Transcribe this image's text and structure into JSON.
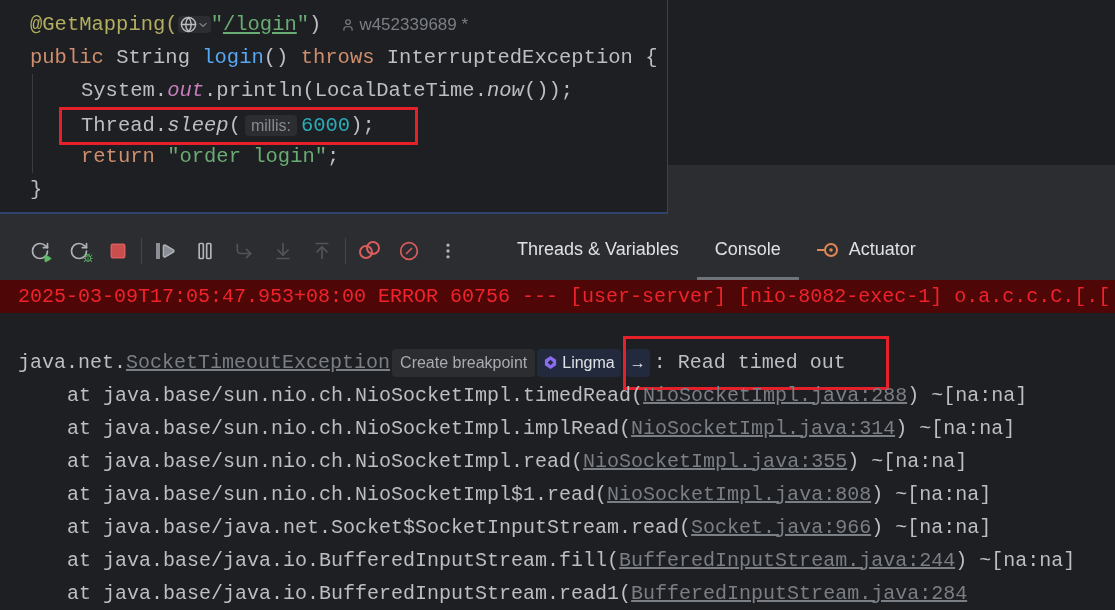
{
  "editor": {
    "lines": [
      {
        "indent": false,
        "highlighted": false,
        "tokens": [
          {
            "kind": "annotation",
            "text": "@GetMapping("
          },
          {
            "kind": "url_icon"
          },
          {
            "kind": "string",
            "text": "\""
          },
          {
            "kind": "string_link",
            "text": "/login"
          },
          {
            "kind": "string",
            "text": "\""
          },
          {
            "kind": "plain",
            "text": ")"
          },
          {
            "kind": "author",
            "text": "w452339689 *"
          }
        ]
      },
      {
        "indent": false,
        "highlighted": false,
        "tokens": [
          {
            "kind": "keyword",
            "text": "public "
          },
          {
            "kind": "plain",
            "text": "String "
          },
          {
            "kind": "method",
            "text": "login"
          },
          {
            "kind": "plain",
            "text": "() "
          },
          {
            "kind": "keyword",
            "text": "throws "
          },
          {
            "kind": "plain",
            "text": "InterruptedException {"
          }
        ]
      },
      {
        "indent": true,
        "highlighted": false,
        "tokens": [
          {
            "kind": "plain",
            "text": "System."
          },
          {
            "kind": "field",
            "text": "out"
          },
          {
            "kind": "plain",
            "text": ".println(LocalDateTime."
          },
          {
            "kind": "static",
            "text": "now"
          },
          {
            "kind": "plain",
            "text": "());"
          }
        ]
      },
      {
        "indent": true,
        "highlighted": true,
        "tokens": [
          {
            "kind": "plain",
            "text": "Thread."
          },
          {
            "kind": "static",
            "text": "sleep"
          },
          {
            "kind": "plain",
            "text": "("
          },
          {
            "kind": "hint",
            "text": "millis:"
          },
          {
            "kind": "number",
            "text": "6000"
          },
          {
            "kind": "plain",
            "text": ");"
          }
        ]
      },
      {
        "indent": true,
        "highlighted": false,
        "tokens": [
          {
            "kind": "keyword",
            "text": "return "
          },
          {
            "kind": "string",
            "text": "\"order login\""
          },
          {
            "kind": "plain",
            "text": ";"
          }
        ]
      },
      {
        "indent": false,
        "highlighted": false,
        "tokens": [
          {
            "kind": "plain",
            "text": "}"
          }
        ]
      }
    ]
  },
  "toolbar": {
    "buttons": [
      {
        "kind": "rerun",
        "disabled": false
      },
      {
        "kind": "rerun_debug",
        "disabled": false
      },
      {
        "kind": "stop",
        "disabled": false
      },
      {
        "kind": "separator"
      },
      {
        "kind": "resume",
        "disabled": false
      },
      {
        "kind": "pause",
        "disabled": false
      },
      {
        "kind": "step_over",
        "disabled": true
      },
      {
        "kind": "step_into",
        "disabled": true
      },
      {
        "kind": "step_out",
        "disabled": true
      },
      {
        "kind": "separator"
      },
      {
        "kind": "breakpoints",
        "disabled": false
      },
      {
        "kind": "mute",
        "disabled": false
      },
      {
        "kind": "more",
        "disabled": false
      }
    ],
    "tabs": [
      {
        "label": "Threads & Variables",
        "selected": false,
        "icon": false
      },
      {
        "label": "Console",
        "selected": true,
        "icon": false
      },
      {
        "label": "Actuator",
        "selected": false,
        "icon": true
      }
    ]
  },
  "console": {
    "error_line": "2025-03-09T17:05:47.953+08:00 ERROR 60756 --- [user-server] [nio-8082-exec-1] o.a.c.c.C.[.[",
    "exception": {
      "prefix": "java.net.",
      "link": "SocketTimeoutException",
      "tooltip": "Create breakpoint",
      "assistant": "Lingma",
      "arrow": "→",
      "message": ": Read timed out",
      "highlighted": true
    },
    "frames": [
      {
        "prefix": "at java.base/sun.nio.ch.NioSocketImpl.timedRead(",
        "link": "NioSocketImpl.java:288",
        "suffix": ") ~[na:na]"
      },
      {
        "prefix": "at java.base/sun.nio.ch.NioSocketImpl.implRead(",
        "link": "NioSocketImpl.java:314",
        "suffix": ") ~[na:na]"
      },
      {
        "prefix": "at java.base/sun.nio.ch.NioSocketImpl.read(",
        "link": "NioSocketImpl.java:355",
        "suffix": ") ~[na:na]"
      },
      {
        "prefix": "at java.base/sun.nio.ch.NioSocketImpl$1.read(",
        "link": "NioSocketImpl.java:808",
        "suffix": ") ~[na:na]"
      },
      {
        "prefix": "at java.base/java.net.Socket$SocketInputStream.read(",
        "link": "Socket.java:966",
        "suffix": ") ~[na:na]"
      },
      {
        "prefix": "at java.base/java.io.BufferedInputStream.fill(",
        "link": "BufferedInputStream.java:244",
        "suffix": ") ~[na:na]"
      },
      {
        "prefix": "at java.base/java.io.BufferedInputStream.read1(",
        "link": "BufferedInputStream.java:284"
      }
    ]
  }
}
